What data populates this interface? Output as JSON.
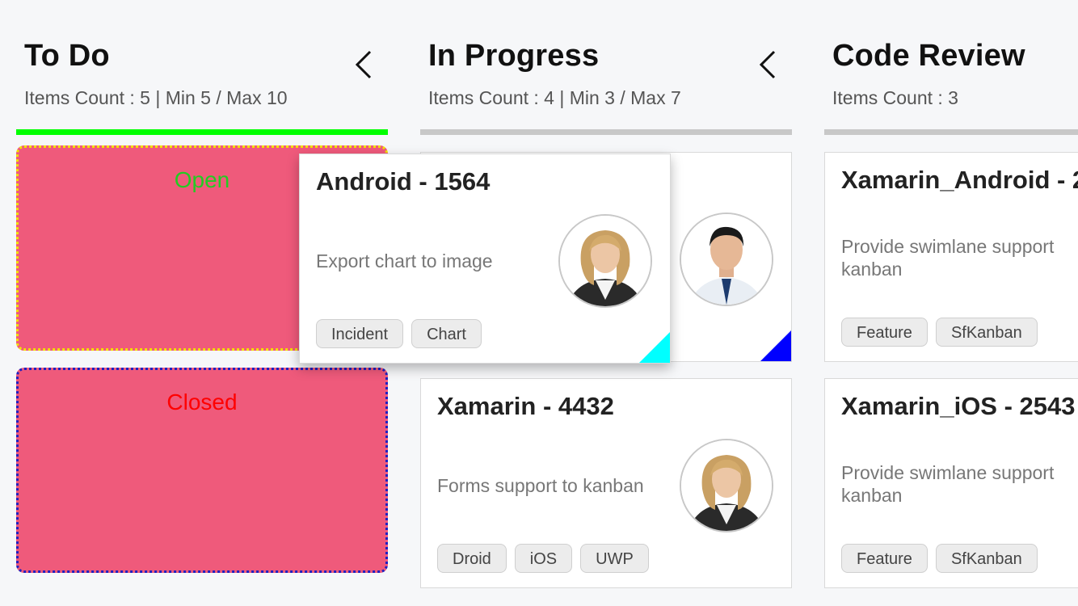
{
  "columns": [
    {
      "title": "To Do",
      "subtitle": "Items Count : 5 | Min 5 / Max 10",
      "bar_color": "#00ff00"
    },
    {
      "title": "In Progress",
      "subtitle": "Items Count : 4 | Min 3 / Max 7",
      "bar_color": "#c8c8c8"
    },
    {
      "title": "Code Review",
      "subtitle": "Items Count : 3",
      "bar_color": "#c8c8c8"
    }
  ],
  "todo_zones": [
    {
      "label": "Open",
      "label_color": "#22cc22",
      "border_color": "#f2e200"
    },
    {
      "label": "Closed",
      "label_color": "#ff0000",
      "border_color": "#2020c0"
    }
  ],
  "dragged_card": {
    "title": "Android - 1564",
    "description": "Export chart to image",
    "tags": [
      "Incident",
      "Chart"
    ],
    "avatar": "woman-avatar",
    "corner_color": "#00ffff"
  },
  "in_progress_cards": [
    {
      "avatar": "man-avatar",
      "corner_color": "#0000ff"
    },
    {
      "title": "Xamarin - 4432",
      "description": "Forms support to kanban",
      "tags": [
        "Droid",
        "iOS",
        "UWP"
      ],
      "avatar": "woman-avatar"
    }
  ],
  "code_review_cards": [
    {
      "title": "Xamarin_Android - 2",
      "description": "Provide swimlane support kanban",
      "tags": [
        "Feature",
        "SfKanban"
      ]
    },
    {
      "title": "Xamarin_iOS - 2543",
      "description": "Provide swimlane support kanban",
      "tags": [
        "Feature",
        "SfKanban"
      ]
    }
  ]
}
